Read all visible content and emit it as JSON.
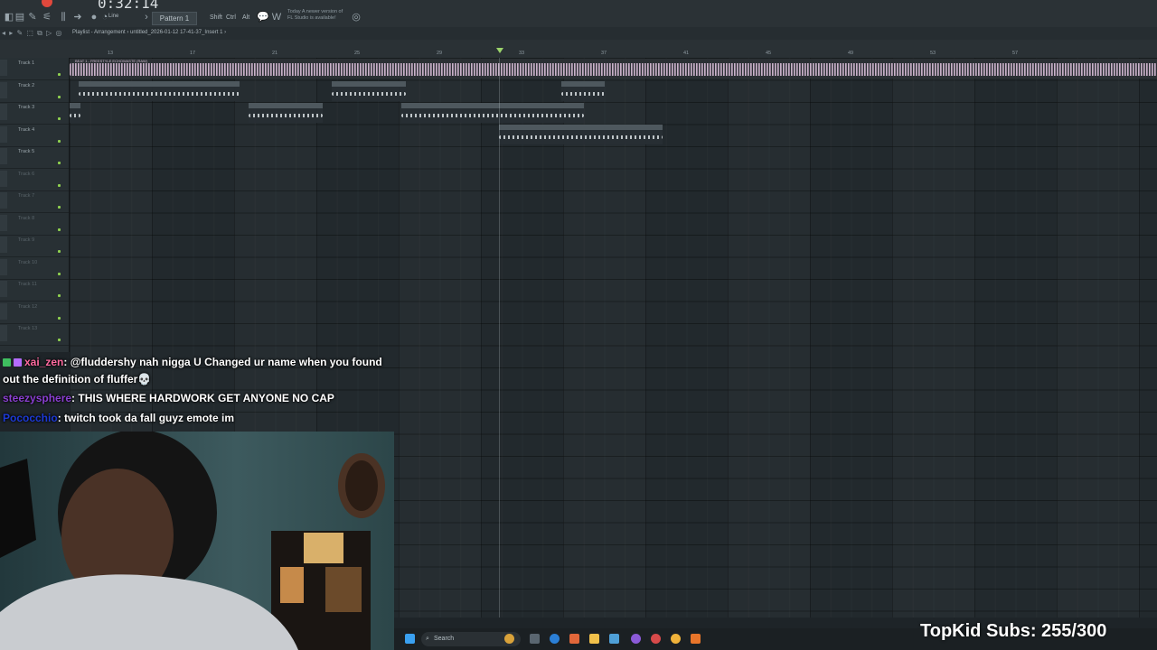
{
  "toolbar": {
    "time": "0:32:14",
    "line_mode": "Line",
    "pattern": "Pattern 1",
    "modifiers": [
      "Shift",
      "Ctrl",
      "Alt"
    ],
    "update_note_lines": [
      "Today  A newer version of",
      "FL Studio is available!"
    ]
  },
  "playlist": {
    "title": "Playlist - Arrangement › untitled_2026-01-12 17-41-37_Insert 1 ›",
    "bar_numbers": [
      "13",
      "17",
      "21",
      "25",
      "29",
      "33",
      "37",
      "41",
      "45",
      "49",
      "53",
      "57"
    ],
    "tracks": [
      {
        "label": "Track 1",
        "active": true
      },
      {
        "label": "Track 2",
        "active": true
      },
      {
        "label": "Track 3",
        "active": true
      },
      {
        "label": "Track 4",
        "active": true
      },
      {
        "label": "Track 5",
        "active": true
      },
      {
        "label": "Track 6",
        "active": false
      },
      {
        "label": "Track 7",
        "active": false
      },
      {
        "label": "Track 8",
        "active": false
      },
      {
        "label": "Track 9",
        "active": false
      },
      {
        "label": "Track 10",
        "active": false
      },
      {
        "label": "Track 11",
        "active": false
      },
      {
        "label": "Track 12",
        "active": false
      },
      {
        "label": "Track 13",
        "active": false
      }
    ],
    "clips": {
      "big": "BEAT 1 - FREESTYLE ECHOWASTE (RAW)",
      "t2a": "untitled_2026-01-12 17-38-35_Insert 1",
      "t2b": "untitled_2026-0...-40-35_Insert 1",
      "t2c": "untitled_Insert 1",
      "t3a": "untitled_2026-0...-39-52_Insert 1",
      "t3b": "untitled_2026-01-12 17-41-24_Insert 1",
      "t4a": "untitled_2026-01-12 17-42-03_Insert 1"
    }
  },
  "chat": [
    {
      "user": "xai_zen",
      "user_color": "#ff6aa0",
      "badges": [
        "#3fbf5f",
        "#b46cff"
      ],
      "message": ": @fluddershy nah nigga U Changed ur name when you found out the definition of fluffer💀"
    },
    {
      "user": "steezysphere",
      "user_color": "#8a3fd1",
      "badges": [],
      "message": ": THIS WHERE HARDWORK GET ANYONE NO CAP"
    },
    {
      "user": "Pococchio",
      "user_color": "#1d3ad6",
      "badges": [],
      "message": ": twitch took da fall guyz emote im"
    }
  ],
  "taskbar": {
    "search_placeholder": "Search"
  },
  "overlay": {
    "subs_text": "TopKid Subs: 255/300"
  }
}
